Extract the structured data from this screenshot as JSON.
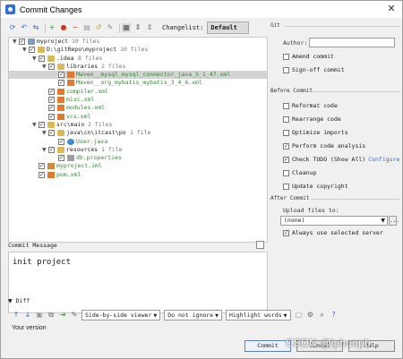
{
  "window": {
    "title": "Commit Changes"
  },
  "toolbar": {
    "icons": [
      "refresh-icon",
      "rollback-icon",
      "diff-icon",
      "add-icon",
      "remove-icon",
      "group-icon",
      "undo-icon",
      "move-icon",
      "expand-all-icon",
      "collapse-all-icon",
      "filter-icon"
    ],
    "changelist_label": "Changelist:",
    "changelist_value": "Default"
  },
  "tree": [
    {
      "indent": 0,
      "expander": "▼",
      "checked": "✓",
      "icon": "module",
      "label": "myproject",
      "count": "10 files",
      "style": "normal"
    },
    {
      "indent": 1,
      "expander": "▼",
      "checked": "✓",
      "icon": "folder",
      "label": "D:\\gitRepo\\myproject",
      "count": "10 files",
      "style": "normal"
    },
    {
      "indent": 2,
      "expander": "▼",
      "checked": "✓",
      "icon": "folder",
      "label": ".idea",
      "count": "8 files",
      "style": "normal"
    },
    {
      "indent": 3,
      "expander": "▼",
      "checked": "✓",
      "icon": "folder",
      "label": "libraries",
      "count": "2 files",
      "style": "normal"
    },
    {
      "indent": 4,
      "expander": "",
      "checked": "✓",
      "icon": "xml",
      "label": "Maven__mysql_mysql_connector_java_5_1_47.xml",
      "count": "",
      "style": "added",
      "selected": true
    },
    {
      "indent": 4,
      "expander": "",
      "checked": "✓",
      "icon": "xml",
      "label": "Maven__org_mybatis_mybatis_3_4_6.xml",
      "count": "",
      "style": "added"
    },
    {
      "indent": 3,
      "expander": "",
      "checked": "✓",
      "icon": "xml",
      "label": "compiler.xml",
      "count": "",
      "style": "added"
    },
    {
      "indent": 3,
      "expander": "",
      "checked": "✓",
      "icon": "xml",
      "label": "misc.xml",
      "count": "",
      "style": "added"
    },
    {
      "indent": 3,
      "expander": "",
      "checked": "✓",
      "icon": "xml",
      "label": "modules.xml",
      "count": "",
      "style": "added"
    },
    {
      "indent": 3,
      "expander": "",
      "checked": "✓",
      "icon": "xml",
      "label": "vcs.xml",
      "count": "",
      "style": "added"
    },
    {
      "indent": 2,
      "expander": "▼",
      "checked": "✓",
      "icon": "folder",
      "label": "src\\main",
      "count": "2 files",
      "style": "normal"
    },
    {
      "indent": 3,
      "expander": "▼",
      "checked": "✓",
      "icon": "folder",
      "label": "java\\cn\\itcast\\po",
      "count": "1 file",
      "style": "normal"
    },
    {
      "indent": 4,
      "expander": "",
      "checked": "✓",
      "icon": "java",
      "label": "User.java",
      "count": "",
      "style": "added"
    },
    {
      "indent": 3,
      "expander": "▼",
      "checked": "✓",
      "icon": "folder",
      "label": "resources",
      "count": "1 file",
      "style": "normal"
    },
    {
      "indent": 4,
      "expander": "",
      "checked": "✓",
      "icon": "props",
      "label": "db.properties",
      "count": "",
      "style": "added"
    },
    {
      "indent": 2,
      "expander": "",
      "checked": "✓",
      "icon": "iml",
      "label": "myproject.iml",
      "count": "",
      "style": "added"
    },
    {
      "indent": 2,
      "expander": "",
      "checked": "✓",
      "icon": "xml",
      "label": "pom.xml",
      "count": "",
      "style": "added"
    }
  ],
  "commit_message": {
    "label": "Commit Message",
    "value": "init project"
  },
  "git": {
    "section": "Git",
    "author_label": "Author:",
    "author_value": "",
    "amend_commit": {
      "label": "Amend commit",
      "checked": ""
    },
    "signoff_commit": {
      "label": "Sign-off commit",
      "checked": ""
    }
  },
  "before_commit": {
    "section": "Before Commit",
    "options": [
      {
        "label": "Reformat code",
        "checked": ""
      },
      {
        "label": "Rearrange code",
        "checked": ""
      },
      {
        "label": "Optimize imports",
        "checked": ""
      },
      {
        "label": "Perform code analysis",
        "checked": "✓"
      },
      {
        "label": "Check TODO (Show All)",
        "checked": "✓",
        "link": "Configure"
      },
      {
        "label": "Cleanup",
        "checked": ""
      },
      {
        "label": "Update copyright",
        "checked": ""
      }
    ]
  },
  "after_commit": {
    "section": "After Commit",
    "upload_label": "Upload files to:",
    "upload_value": "(none)",
    "upload_button": "...",
    "always_selected": {
      "label": "Always use selected server",
      "checked": "✓"
    }
  },
  "diff": {
    "header": "Diff",
    "viewer": "Side-by-side viewer",
    "ignore": "Do not ignore",
    "highlight": "Highlight words",
    "help": "?",
    "your_version": "Your version"
  },
  "buttons": {
    "commit": "Commit",
    "cancel": "Cancel",
    "help": "Help"
  },
  "watermark": "CSDN @iphuopb"
}
